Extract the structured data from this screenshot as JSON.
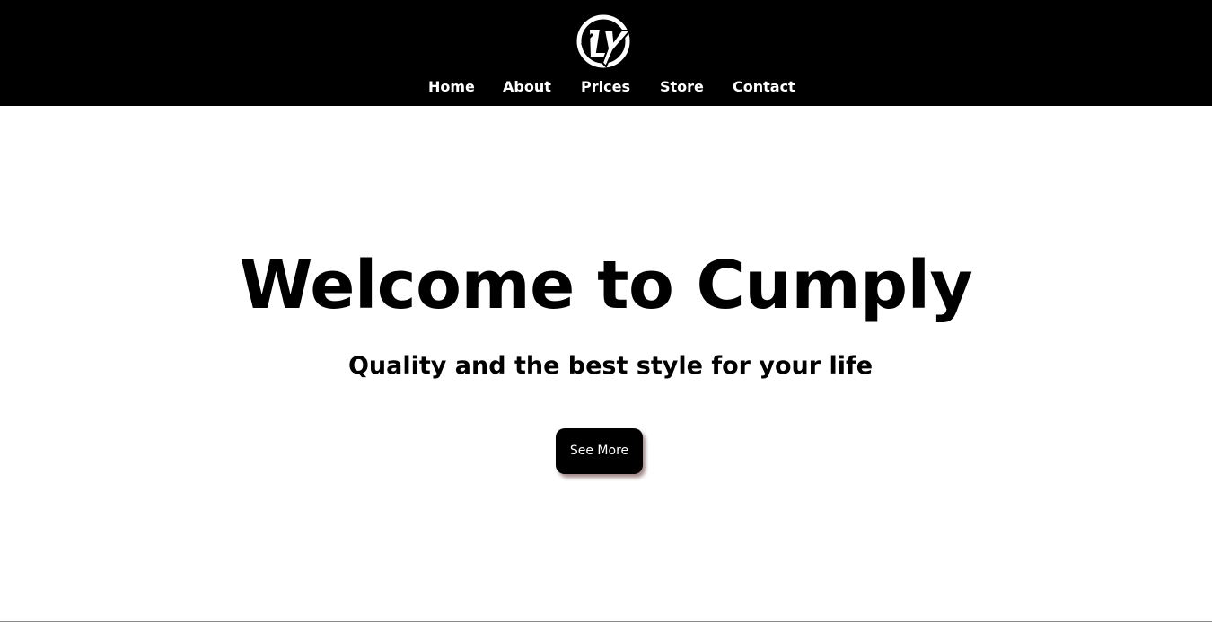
{
  "header": {
    "logo_icon": "cly-monogram-logo",
    "background_color": "#000000",
    "text_color": "#ffffff"
  },
  "nav": {
    "items": [
      {
        "label": "Home"
      },
      {
        "label": "About"
      },
      {
        "label": "Prices"
      },
      {
        "label": "Store"
      },
      {
        "label": "Contact"
      }
    ]
  },
  "hero": {
    "title": "Welcome to Cumply",
    "subtitle": "Quality and the best style for your life",
    "cta_label": "See More",
    "cta_background": "#000000"
  }
}
